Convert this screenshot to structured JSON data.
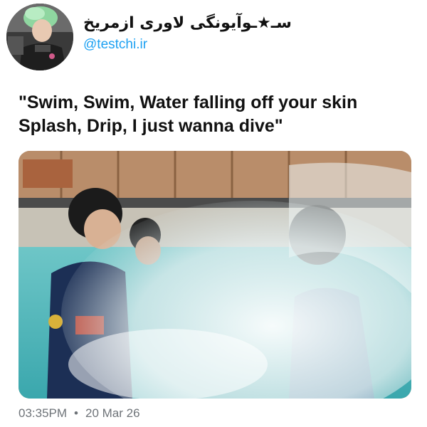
{
  "tweet": {
    "author": {
      "display_name": "سـ★ـوآیونگی لاوری ازمریخ",
      "handle": "@testchi.ir",
      "avatar_icon": "avatar-photo"
    },
    "text_lines": [
      "\"Swim, Swim, Water falling off your skin",
      "Splash, Drip, I just wanna dive\""
    ],
    "media": {
      "type": "photo",
      "description_icon": "pool-splash-photo"
    },
    "meta": {
      "time": "03:35PM",
      "separator": "•",
      "date": "20 Mar 26"
    },
    "colors": {
      "handle": "#1da1f2",
      "text": "#111111",
      "meta": "#6e7378",
      "background": "#ffffff"
    }
  }
}
